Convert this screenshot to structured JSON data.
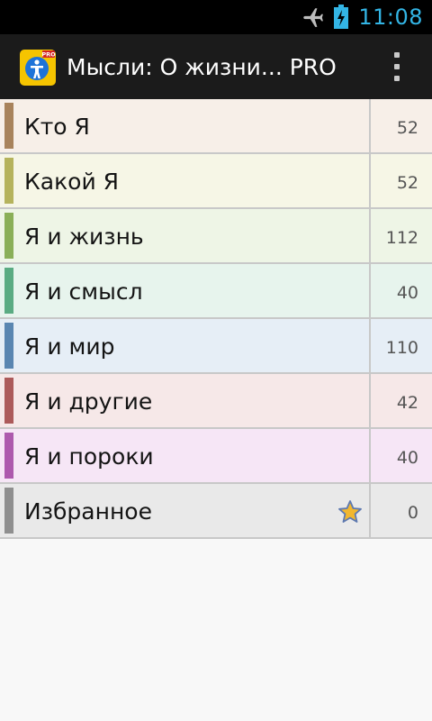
{
  "status_bar": {
    "time": "11:08",
    "icons": [
      "airplane-mode-icon",
      "battery-charging-icon"
    ]
  },
  "action_bar": {
    "title": "Мысли: О жизни... PRO",
    "app_icon": "app-logo-icon",
    "app_icon_badge": "PRO",
    "menu_icon": "overflow-menu-icon"
  },
  "categories": [
    {
      "label": "Кто Я",
      "count": "52",
      "color": "#a8835c",
      "bg": "#f7efe8"
    },
    {
      "label": "Какой Я",
      "count": "52",
      "color": "#b5b35c",
      "bg": "#f6f6e6"
    },
    {
      "label": "Я и жизнь",
      "count": "112",
      "color": "#8aaf58",
      "bg": "#eef5e6"
    },
    {
      "label": "Я и смысл",
      "count": "40",
      "color": "#5aab82",
      "bg": "#e7f4ed"
    },
    {
      "label": "Я и мир",
      "count": "110",
      "color": "#5a86b1",
      "bg": "#e6eef6"
    },
    {
      "label": "Я и другие",
      "count": "42",
      "color": "#ac5a5a",
      "bg": "#f6e8e8"
    },
    {
      "label": "Я и пороки",
      "count": "40",
      "color": "#ad59ad",
      "bg": "#f6e6f6"
    },
    {
      "label": "Избранное",
      "count": "0",
      "color": "#8f8f8f",
      "bg": "#e9e9e9",
      "icon": "star-icon"
    }
  ]
}
